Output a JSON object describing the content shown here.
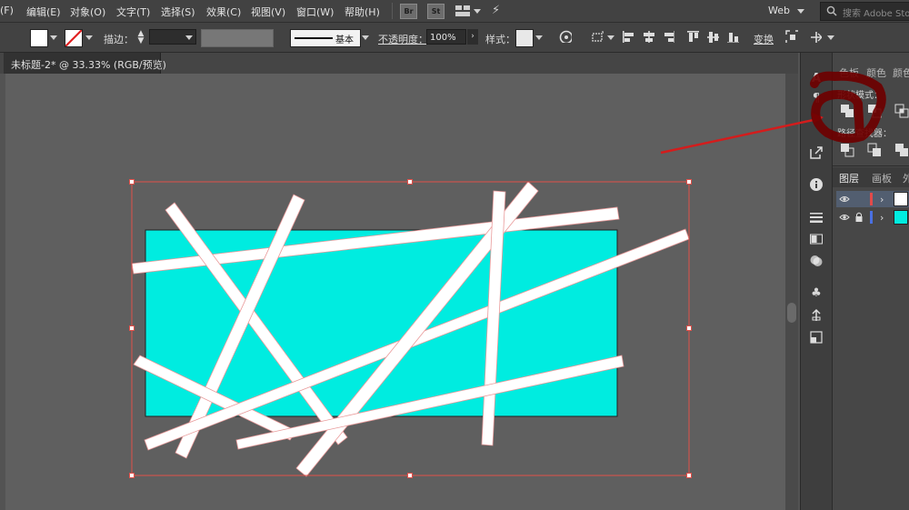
{
  "menu": [
    "(F)",
    "编辑(E)",
    "对象(O)",
    "文字(T)",
    "选择(S)",
    "效果(C)",
    "视图(V)",
    "窗口(W)",
    "帮助(H)"
  ],
  "app_buttons": [
    "Br",
    "St"
  ],
  "workspace": "Web",
  "search": {
    "placeholder": "搜索 Adobe Stock"
  },
  "control": {
    "stroke_label": "描边：",
    "brush_label": "基本",
    "opacity_label": "不透明度：",
    "opacity_value": "100%",
    "style_label": "样式：",
    "transform_label": "变换"
  },
  "document_tab": "未标题-2* @ 33.33% (RGB/预览)",
  "panels": {
    "tabs": [
      "色板",
      "颜色",
      "颜色"
    ],
    "shape_modes_label": "形状模式：",
    "pathfinder_label": "路径查找器：",
    "layer_tabs": [
      "图层",
      "画板",
      "外"
    ]
  },
  "colors": {
    "rect_fill": "#00ece0",
    "stripe_fill": "#ffffff",
    "selection": "#e0504a",
    "arrow": "#d41c1c",
    "marker": "#6e0000"
  },
  "annotation": {
    "marker_glyph": "a"
  }
}
